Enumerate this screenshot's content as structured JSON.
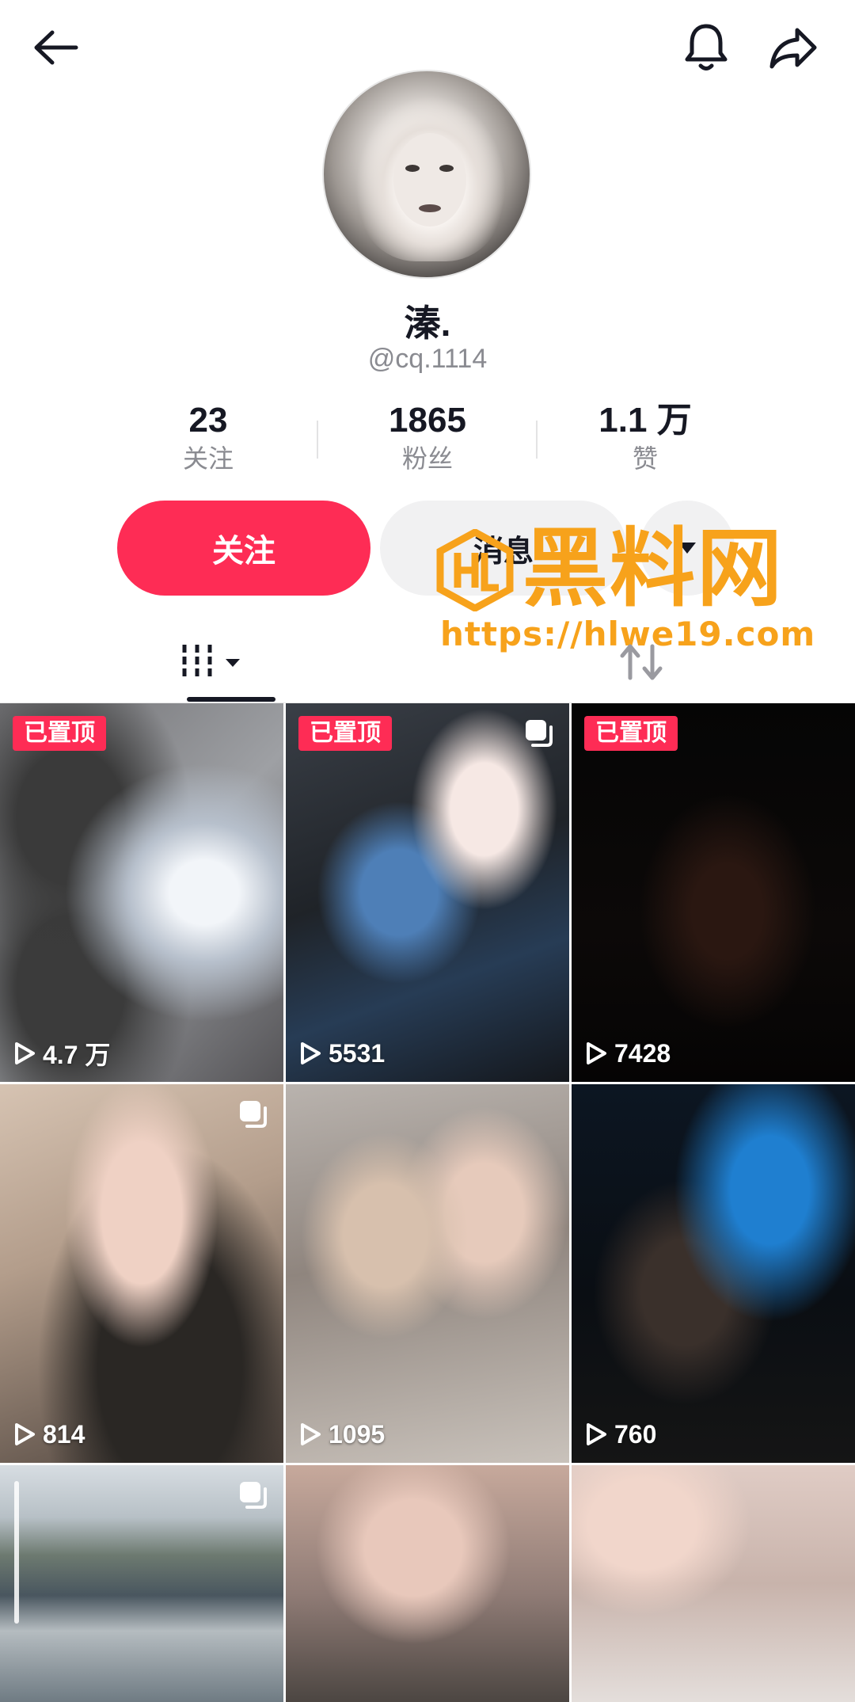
{
  "header": {
    "icons": {
      "back": "arrow-left-icon",
      "bell": "bell-icon",
      "share": "share-icon"
    }
  },
  "profile": {
    "nickname": "溱.",
    "handle": "@cq.1114",
    "avatar": "avatar-photo"
  },
  "stats": {
    "following": {
      "value": "23",
      "label": "关注"
    },
    "followers": {
      "value": "1865",
      "label": "粉丝"
    },
    "likes": {
      "value": "1.1 万",
      "label": "赞"
    }
  },
  "actions": {
    "follow_label": "关注",
    "message_label": "消息"
  },
  "watermark": {
    "title": "黑料网",
    "url": "https://hlwe19.com"
  },
  "tabs": {
    "videos_icon": "video-grid-icon",
    "reposts_icon": "repost-icon"
  },
  "colors": {
    "accent": "#fe2c55",
    "watermark": "#f7a21b",
    "text_primary": "#161823",
    "text_secondary": "#8a8b91"
  },
  "videos": [
    {
      "pinned": "已置顶",
      "plays": "4.7 万",
      "multi": false
    },
    {
      "pinned": "已置顶",
      "plays": "5531",
      "multi": true
    },
    {
      "pinned": "已置顶",
      "plays": "7428",
      "multi": false
    },
    {
      "pinned": "",
      "plays": "814",
      "multi": true
    },
    {
      "pinned": "",
      "plays": "1095",
      "multi": false
    },
    {
      "pinned": "",
      "plays": "760",
      "multi": false
    },
    {
      "pinned": "",
      "plays": "",
      "multi": true
    },
    {
      "pinned": "",
      "plays": "",
      "multi": false
    },
    {
      "pinned": "",
      "plays": "",
      "multi": false
    }
  ]
}
